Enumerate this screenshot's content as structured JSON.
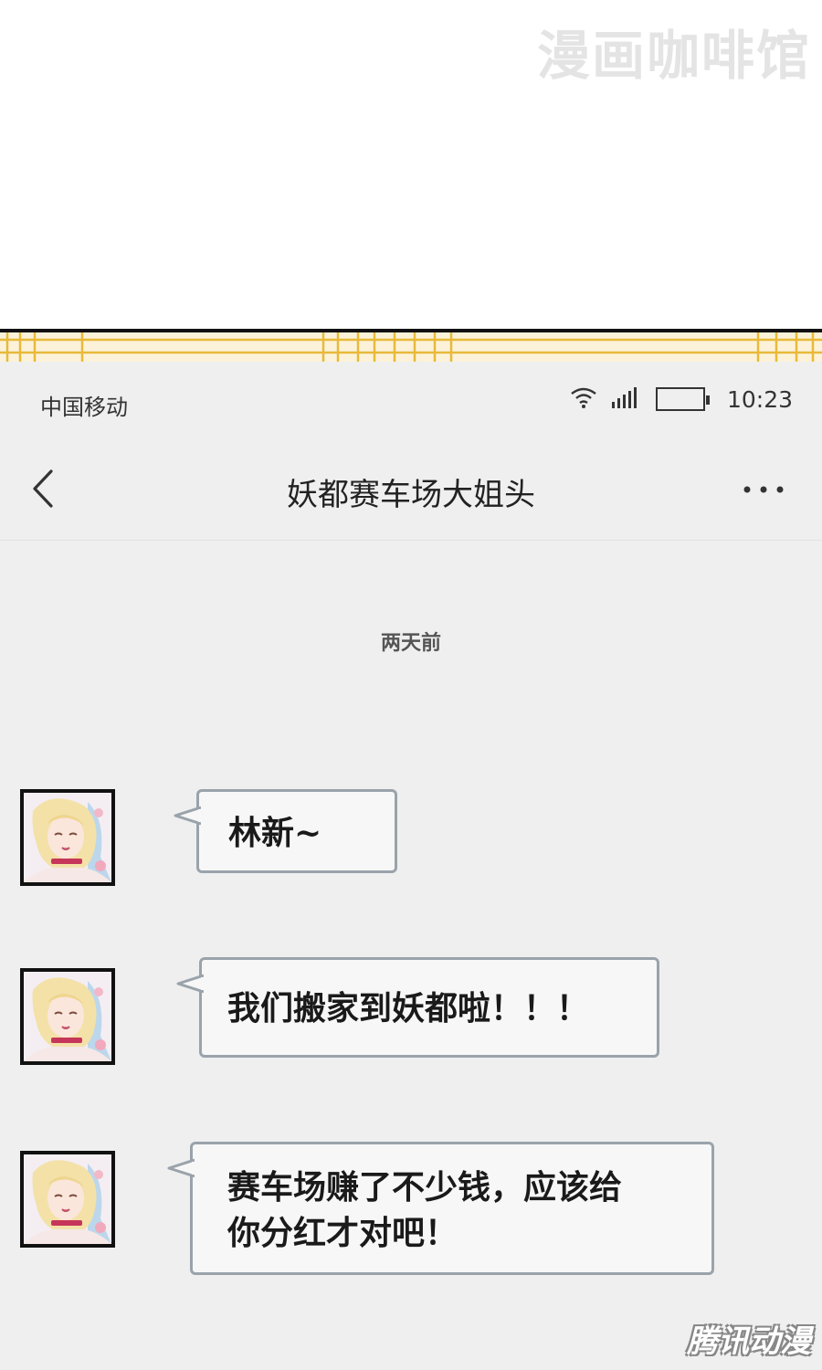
{
  "watermark_top": "漫画咖啡馆",
  "watermark_bottom": "腾讯动漫",
  "status_bar": {
    "carrier": "中国移动",
    "time": "10:23"
  },
  "nav": {
    "title": "妖都赛车场大姐头",
    "back_icon": "chevron-left-icon",
    "more_icon": "more-dots-icon"
  },
  "chat": {
    "time_label": "两天前",
    "messages": [
      {
        "sender": "incoming",
        "text": "林新~"
      },
      {
        "sender": "incoming",
        "text": "我们搬家到妖都啦！！！"
      },
      {
        "sender": "incoming",
        "lines": [
          "赛车场赚了不少钱，应该给",
          "你分红才对吧！"
        ]
      }
    ]
  },
  "colors": {
    "chat_background": "#efefef",
    "bubble_fill": "#f7f7f7",
    "bubble_border": "#9aa3ab",
    "border_strip": "#fbf2d9",
    "border_lines": "#e8b93a"
  }
}
